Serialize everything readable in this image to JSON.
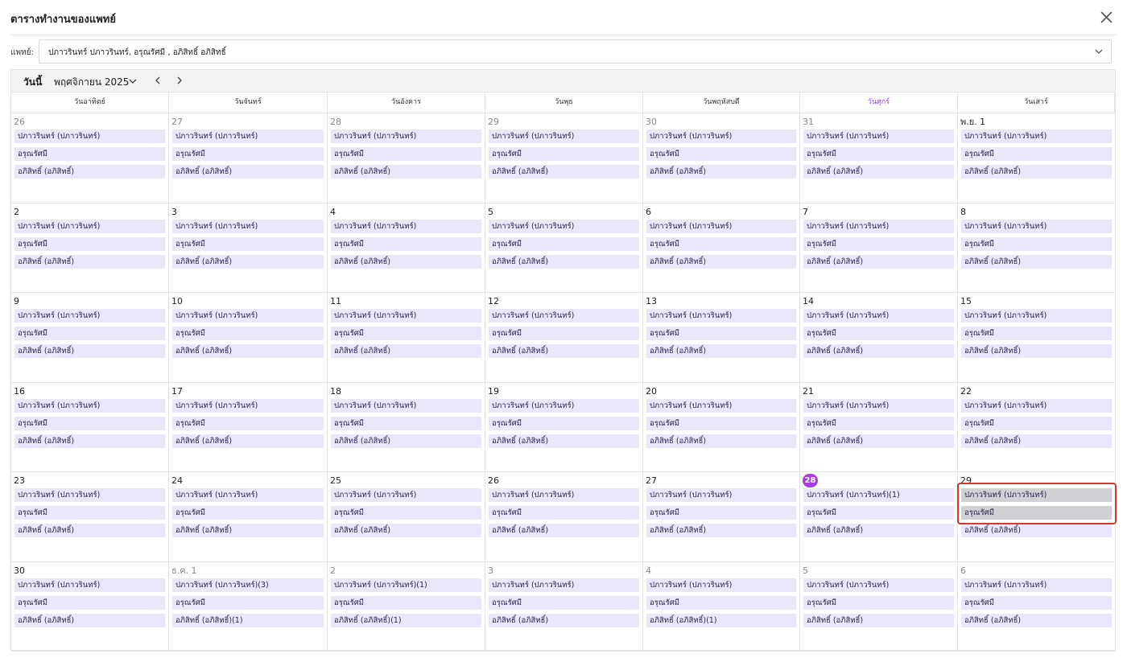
{
  "header": {
    "title": "ตารางทำงานของแพทย์",
    "close_icon": "close-icon"
  },
  "filter": {
    "label": "แพทย์:",
    "selected": "ปภาวรินทร์ ปภาวรินทร์, อรุณรัศมี , อภิสิทธิ์ อภิสิทธิ์"
  },
  "toolbar": {
    "today": "วันนี้",
    "month": "พฤศจิกายน 2025"
  },
  "weekdays": [
    "วันอาทิตย์",
    "วันจันทร์",
    "วันอังคาร",
    "วันพุธ",
    "วันพฤหัสบดี",
    "วันศุกร์",
    "วันเสาร์"
  ],
  "colors": {
    "accent": "#a63de3",
    "event_bg": "#ece6fb",
    "selected_event_bg": "#d0d0d5",
    "selection_border": "#d9362e"
  },
  "weeks": [
    [
      {
        "label": "26",
        "other": true,
        "events": [
          "ปภาวรินทร์ (ปภาวรินทร์)",
          "อรุณรัศมี",
          "อภิสิทธิ์ (อภิสิทธิ์)"
        ]
      },
      {
        "label": "27",
        "other": true,
        "events": [
          "ปภาวรินทร์ (ปภาวรินทร์)",
          "อรุณรัศมี",
          "อภิสิทธิ์ (อภิสิทธิ์)"
        ]
      },
      {
        "label": "28",
        "other": true,
        "events": [
          "ปภาวรินทร์ (ปภาวรินทร์)",
          "อรุณรัศมี",
          "อภิสิทธิ์ (อภิสิทธิ์)"
        ]
      },
      {
        "label": "29",
        "other": true,
        "events": [
          "ปภาวรินทร์ (ปภาวรินทร์)",
          "อรุณรัศมี",
          "อภิสิทธิ์ (อภิสิทธิ์)"
        ]
      },
      {
        "label": "30",
        "other": true,
        "events": [
          "ปภาวรินทร์ (ปภาวรินทร์)",
          "อรุณรัศมี",
          "อภิสิทธิ์ (อภิสิทธิ์)"
        ]
      },
      {
        "label": "31",
        "other": true,
        "events": [
          "ปภาวรินทร์ (ปภาวรินทร์)",
          "อรุณรัศมี",
          "อภิสิทธิ์ (อภิสิทธิ์)"
        ]
      },
      {
        "label": "พ.ย. 1",
        "events": [
          "ปภาวรินทร์ (ปภาวรินทร์)",
          "อรุณรัศมี",
          "อภิสิทธิ์ (อภิสิทธิ์)"
        ]
      }
    ],
    [
      {
        "label": "2",
        "events": [
          "ปภาวรินทร์ (ปภาวรินทร์)",
          "อรุณรัศมี",
          "อภิสิทธิ์ (อภิสิทธิ์)"
        ]
      },
      {
        "label": "3",
        "events": [
          "ปภาวรินทร์ (ปภาวรินทร์)",
          "อรุณรัศมี",
          "อภิสิทธิ์ (อภิสิทธิ์)"
        ]
      },
      {
        "label": "4",
        "events": [
          "ปภาวรินทร์ (ปภาวรินทร์)",
          "อรุณรัศมี",
          "อภิสิทธิ์ (อภิสิทธิ์)"
        ]
      },
      {
        "label": "5",
        "events": [
          "ปภาวรินทร์ (ปภาวรินทร์)",
          "อรุณรัศมี",
          "อภิสิทธิ์ (อภิสิทธิ์)"
        ]
      },
      {
        "label": "6",
        "events": [
          "ปภาวรินทร์ (ปภาวรินทร์)",
          "อรุณรัศมี",
          "อภิสิทธิ์ (อภิสิทธิ์)"
        ]
      },
      {
        "label": "7",
        "events": [
          "ปภาวรินทร์ (ปภาวรินทร์)",
          "อรุณรัศมี",
          "อภิสิทธิ์ (อภิสิทธิ์)"
        ]
      },
      {
        "label": "8",
        "events": [
          "ปภาวรินทร์ (ปภาวรินทร์)",
          "อรุณรัศมี",
          "อภิสิทธิ์ (อภิสิทธิ์)"
        ]
      }
    ],
    [
      {
        "label": "9",
        "events": [
          "ปภาวรินทร์ (ปภาวรินทร์)",
          "อรุณรัศมี",
          "อภิสิทธิ์ (อภิสิทธิ์)"
        ]
      },
      {
        "label": "10",
        "events": [
          "ปภาวรินทร์ (ปภาวรินทร์)",
          "อรุณรัศมี",
          "อภิสิทธิ์ (อภิสิทธิ์)"
        ]
      },
      {
        "label": "11",
        "events": [
          "ปภาวรินทร์ (ปภาวรินทร์)",
          "อรุณรัศมี",
          "อภิสิทธิ์ (อภิสิทธิ์)"
        ]
      },
      {
        "label": "12",
        "events": [
          "ปภาวรินทร์ (ปภาวรินทร์)",
          "อรุณรัศมี",
          "อภิสิทธิ์ (อภิสิทธิ์)"
        ]
      },
      {
        "label": "13",
        "events": [
          "ปภาวรินทร์ (ปภาวรินทร์)",
          "อรุณรัศมี",
          "อภิสิทธิ์ (อภิสิทธิ์)"
        ]
      },
      {
        "label": "14",
        "events": [
          "ปภาวรินทร์ (ปภาวรินทร์)",
          "อรุณรัศมี",
          "อภิสิทธิ์ (อภิสิทธิ์)"
        ]
      },
      {
        "label": "15",
        "events": [
          "ปภาวรินทร์ (ปภาวรินทร์)",
          "อรุณรัศมี",
          "อภิสิทธิ์ (อภิสิทธิ์)"
        ]
      }
    ],
    [
      {
        "label": "16",
        "events": [
          "ปภาวรินทร์ (ปภาวรินทร์)",
          "อรุณรัศมี",
          "อภิสิทธิ์ (อภิสิทธิ์)"
        ]
      },
      {
        "label": "17",
        "events": [
          "ปภาวรินทร์ (ปภาวรินทร์)",
          "อรุณรัศมี",
          "อภิสิทธิ์ (อภิสิทธิ์)"
        ]
      },
      {
        "label": "18",
        "events": [
          "ปภาวรินทร์ (ปภาวรินทร์)",
          "อรุณรัศมี",
          "อภิสิทธิ์ (อภิสิทธิ์)"
        ]
      },
      {
        "label": "19",
        "events": [
          "ปภาวรินทร์ (ปภาวรินทร์)",
          "อรุณรัศมี",
          "อภิสิทธิ์ (อภิสิทธิ์)"
        ]
      },
      {
        "label": "20",
        "events": [
          "ปภาวรินทร์ (ปภาวรินทร์)",
          "อรุณรัศมี",
          "อภิสิทธิ์ (อภิสิทธิ์)"
        ]
      },
      {
        "label": "21",
        "events": [
          "ปภาวรินทร์ (ปภาวรินทร์)",
          "อรุณรัศมี",
          "อภิสิทธิ์ (อภิสิทธิ์)"
        ]
      },
      {
        "label": "22",
        "events": [
          "ปภาวรินทร์ (ปภาวรินทร์)",
          "อรุณรัศมี",
          "อภิสิทธิ์ (อภิสิทธิ์)"
        ]
      }
    ],
    [
      {
        "label": "23",
        "events": [
          "ปภาวรินทร์ (ปภาวรินทร์)",
          "อรุณรัศมี",
          "อภิสิทธิ์ (อภิสิทธิ์)"
        ]
      },
      {
        "label": "24",
        "events": [
          "ปภาวรินทร์ (ปภาวรินทร์)",
          "อรุณรัศมี",
          "อภิสิทธิ์ (อภิสิทธิ์)"
        ]
      },
      {
        "label": "25",
        "events": [
          "ปภาวรินทร์ (ปภาวรินทร์)",
          "อรุณรัศมี",
          "อภิสิทธิ์ (อภิสิทธิ์)"
        ]
      },
      {
        "label": "26",
        "events": [
          "ปภาวรินทร์ (ปภาวรินทร์)",
          "อรุณรัศมี",
          "อภิสิทธิ์ (อภิสิทธิ์)"
        ]
      },
      {
        "label": "27",
        "events": [
          "ปภาวรินทร์ (ปภาวรินทร์)",
          "อรุณรัศมี",
          "อภิสิทธิ์ (อภิสิทธิ์)"
        ]
      },
      {
        "label": "28",
        "today": true,
        "events": [
          "ปภาวรินทร์ (ปภาวรินทร์)(1)",
          "อรุณรัศมี",
          "อภิสิทธิ์ (อภิสิทธิ์)"
        ]
      },
      {
        "label": "29",
        "selected_events": [
          0,
          1
        ],
        "events": [
          "ปภาวรินทร์ (ปภาวรินทร์)",
          "อรุณรัศมี",
          "อภิสิทธิ์ (อภิสิทธิ์)"
        ]
      }
    ],
    [
      {
        "label": "30",
        "events": [
          "ปภาวรินทร์ (ปภาวรินทร์)",
          "อรุณรัศมี",
          "อภิสิทธิ์ (อภิสิทธิ์)"
        ]
      },
      {
        "label": "ธ.ค. 1",
        "other": true,
        "events": [
          "ปภาวรินทร์ (ปภาวรินทร์)(3)",
          "อรุณรัศมี",
          "อภิสิทธิ์ (อภิสิทธิ์)(1)"
        ]
      },
      {
        "label": "2",
        "other": true,
        "events": [
          "ปภาวรินทร์ (ปภาวรินทร์)(1)",
          "อรุณรัศมี",
          "อภิสิทธิ์ (อภิสิทธิ์)(1)"
        ]
      },
      {
        "label": "3",
        "other": true,
        "events": [
          "ปภาวรินทร์ (ปภาวรินทร์)",
          "อรุณรัศมี",
          "อภิสิทธิ์ (อภิสิทธิ์)"
        ]
      },
      {
        "label": "4",
        "other": true,
        "events": [
          "ปภาวรินทร์ (ปภาวรินทร์)",
          "อรุณรัศมี",
          "อภิสิทธิ์ (อภิสิทธิ์)(1)"
        ]
      },
      {
        "label": "5",
        "other": true,
        "events": [
          "ปภาวรินทร์ (ปภาวรินทร์)",
          "อรุณรัศมี",
          "อภิสิทธิ์ (อภิสิทธิ์)"
        ]
      },
      {
        "label": "6",
        "other": true,
        "events": [
          "ปภาวรินทร์ (ปภาวรินทร์)",
          "อรุณรัศมี",
          "อภิสิทธิ์ (อภิสิทธิ์)"
        ]
      }
    ]
  ]
}
